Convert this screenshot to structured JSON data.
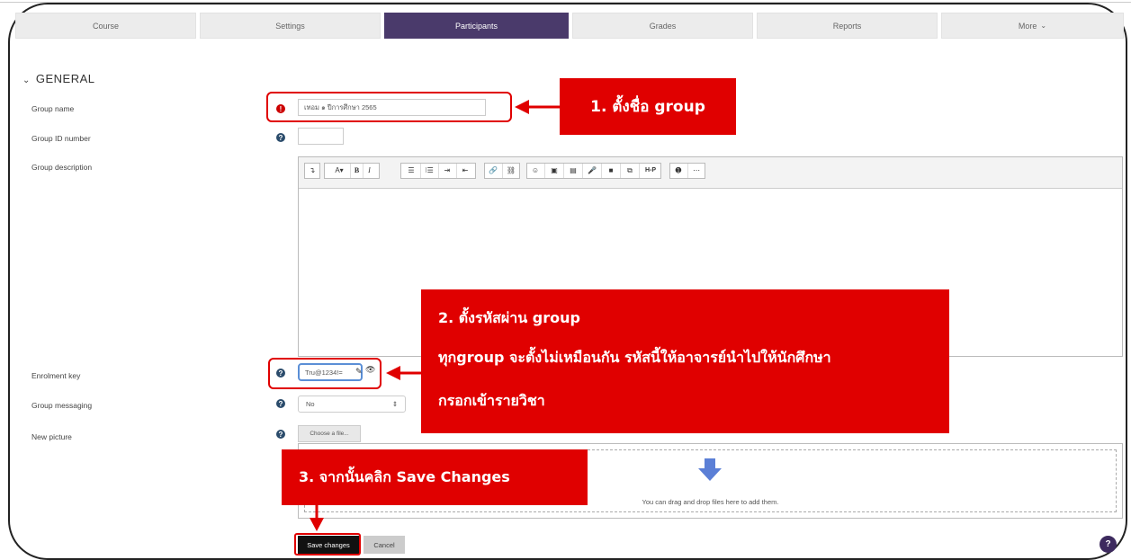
{
  "tabs": [
    {
      "label": "Course"
    },
    {
      "label": "Settings"
    },
    {
      "label": "Participants",
      "active": true
    },
    {
      "label": "Grades"
    },
    {
      "label": "Reports"
    },
    {
      "label": "More"
    }
  ],
  "section_title": "GENERAL",
  "fields": {
    "group_name": {
      "label": "Group name",
      "value": "เทอม ๑ ปีการศึกษา 2565"
    },
    "group_id": {
      "label": "Group ID number",
      "value": ""
    },
    "group_description": {
      "label": "Group description"
    },
    "enrolment_key": {
      "label": "Enrolment key",
      "value": "Tru@1234!="
    },
    "group_messaging": {
      "label": "Group messaging",
      "value": "No"
    },
    "new_picture": {
      "label": "New picture",
      "choose_label": "Choose a file...",
      "drop_text": "You can drag and drop files here to add them."
    }
  },
  "toolbar": [
    "↴",
    "A▾",
    "B",
    "I",
    "☰",
    "⁝☰",
    "⇥",
    "⇤",
    "🔗",
    "⛓",
    "☺",
    "▣",
    "▤",
    "🎤",
    "■",
    "⧉",
    "H-P",
    "➊",
    "⋯"
  ],
  "buttons": {
    "save": "Save changes",
    "cancel": "Cancel",
    "help": "?"
  },
  "callouts": {
    "step1": "1. ตั้งชื่อ group",
    "step2_line1": "2. ตั้งรหัสผ่าน group",
    "step2_line2": "ทุกgroup จะตั้งไม่เหมือนกัน รหัสนี้ให้อาจารย์นำไปให้นักศึกษา",
    "step2_line3": "กรอกเข้ารายวิชา",
    "step3": "3. จากนั้นคลิก Save Changes"
  },
  "colors": {
    "accent": "#4a3a6b",
    "callout": "#e00000"
  }
}
